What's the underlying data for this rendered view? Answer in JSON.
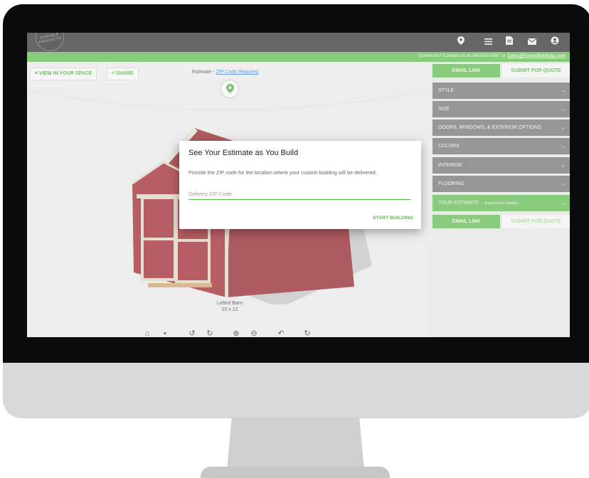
{
  "header": {
    "logo_text": "DURABLE PRODUCTS",
    "contact_prefix": "Questions? Contact us at 540-809-0587 or ",
    "contact_email": "Sales@BaxterBuildings.com"
  },
  "viewer": {
    "view_in_space": "VIEW IN YOUR SPACE",
    "share": "SHARE",
    "estimate_prefix": "Estimate - ",
    "estimate_link": "ZIP Code Required",
    "building_name": "Lofted Barn",
    "building_size": "10 x 12"
  },
  "panel": {
    "email_link": "EMAIL LINK",
    "submit_quote": "SUBMIT FOR QUOTE",
    "sections": [
      "STYLE",
      "SIZE",
      "DOORS, WINDOWS, & EXTERIOR OPTIONS",
      "COLORS",
      "INTERIOR",
      "FLOORING"
    ],
    "estimate_label": "YOUR ESTIMATE: -",
    "estimate_hint": "(expand for details)"
  },
  "modal": {
    "title": "See Your Estimate as You Build",
    "text": "Provide the ZIP code for the location where your custom building will be delivered:",
    "zip_placeholder": "Delivery ZIP Code",
    "zip_value": "",
    "start_button": "START BUILDING"
  },
  "colors": {
    "accent": "#5cb84a",
    "header": "#2b2b2b",
    "section": "#6e6e6e",
    "shed_red": "#9b2129"
  }
}
